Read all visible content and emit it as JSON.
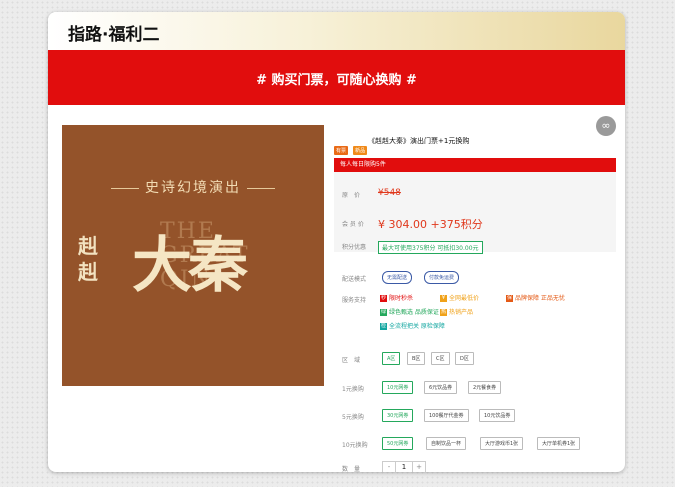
{
  "header": {
    "title": "指路·福利二"
  },
  "banner": {
    "text": "# 购买门票，可随心换购 #"
  },
  "share": {
    "icon": "link-icon",
    "glyph": "∞"
  },
  "poster": {
    "tagline": "史诗幻境演出",
    "english": [
      "THE",
      "GREAT",
      "QIN"
    ],
    "small_title": "赳赳",
    "big_title": "大秦"
  },
  "product": {
    "tags": [
      "有票",
      "新品"
    ],
    "title": "《赳赳大秦》演出门票+1元换购",
    "limit": "每人每日限购5件"
  },
  "price": {
    "orig_label": "原　价",
    "orig_value": "¥548",
    "member_label": "会 员 价",
    "member_value": "¥ 304.00 +375积分",
    "coupon_label": "积分优惠",
    "coupon_value": "最大可使用375积分 可抵扣30.00元"
  },
  "delivery": {
    "label": "配送模式",
    "options": [
      "无需配送",
      "付款免运费"
    ]
  },
  "service": {
    "label": "服务支持",
    "items": [
      {
        "text": "限时秒杀",
        "color": "#e10d0d"
      },
      {
        "text": "全网最低价",
        "color": "#f0a21a"
      },
      {
        "text": "品牌保障 正品无忧",
        "color": "#e45a16"
      },
      {
        "text": "绿色甄选 品质保证",
        "color": "#24a85c"
      },
      {
        "text": "热销产品",
        "color": "#f0a21a"
      },
      {
        "text": "全流程把关 原检保障",
        "color": "#12a6a0"
      }
    ]
  },
  "zone": {
    "label": "区　域",
    "options": [
      "A区",
      "B区",
      "C区",
      "D区"
    ]
  },
  "buy1": {
    "label": "1元换购",
    "options": [
      "10元网券",
      "6元饮品券",
      "2元餐食券"
    ]
  },
  "buy5": {
    "label": "5元换购",
    "options": [
      "30元网券",
      "100餐厅代金券",
      "10元饮品券"
    ]
  },
  "buy10": {
    "label": "10元换购",
    "options": [
      "50元网券",
      "自制饮品一杯",
      "大厅游戏币1张",
      "大厅单机券1张"
    ]
  },
  "quantity": {
    "label": "数　量",
    "minus": "-",
    "value": "1",
    "plus": "+"
  }
}
